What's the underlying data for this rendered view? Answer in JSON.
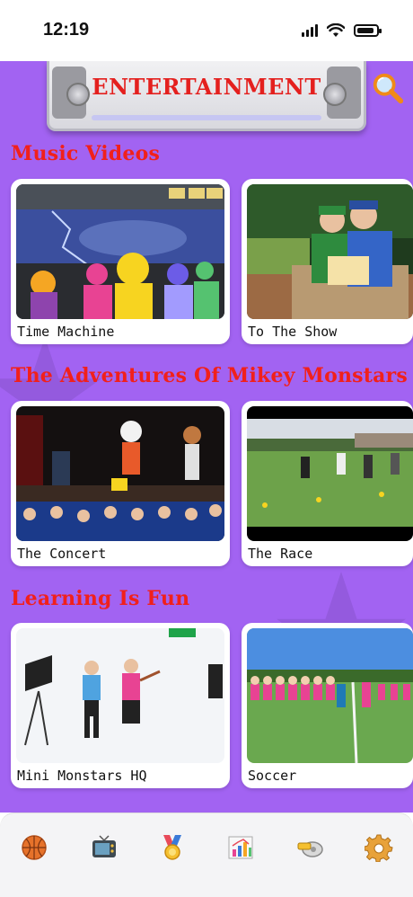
{
  "status_bar": {
    "time": "12:19"
  },
  "header": {
    "title": "ENTERTAINMENT",
    "search_icon": "magnifier-icon"
  },
  "sections": [
    {
      "title": "Music Videos",
      "cards": [
        {
          "label": "Time Machine"
        },
        {
          "label": "To The Show"
        }
      ]
    },
    {
      "title": "The Adventures Of Mikey Monstars",
      "cards": [
        {
          "label": "The Concert"
        },
        {
          "label": "The Race"
        }
      ]
    },
    {
      "title": "Learning Is Fun",
      "cards": [
        {
          "label": "Mini Monstars HQ"
        },
        {
          "label": "Soccer"
        }
      ]
    }
  ],
  "tab_bar": {
    "items": [
      {
        "icon": "basketball-icon"
      },
      {
        "icon": "tv-icon"
      },
      {
        "icon": "medal-icon"
      },
      {
        "icon": "bar-chart-icon"
      },
      {
        "icon": "whistle-icon"
      },
      {
        "icon": "gear-icon"
      }
    ]
  },
  "colors": {
    "background": "#a263f2",
    "section_title": "#f1201b",
    "banner_title": "#e4201e"
  }
}
